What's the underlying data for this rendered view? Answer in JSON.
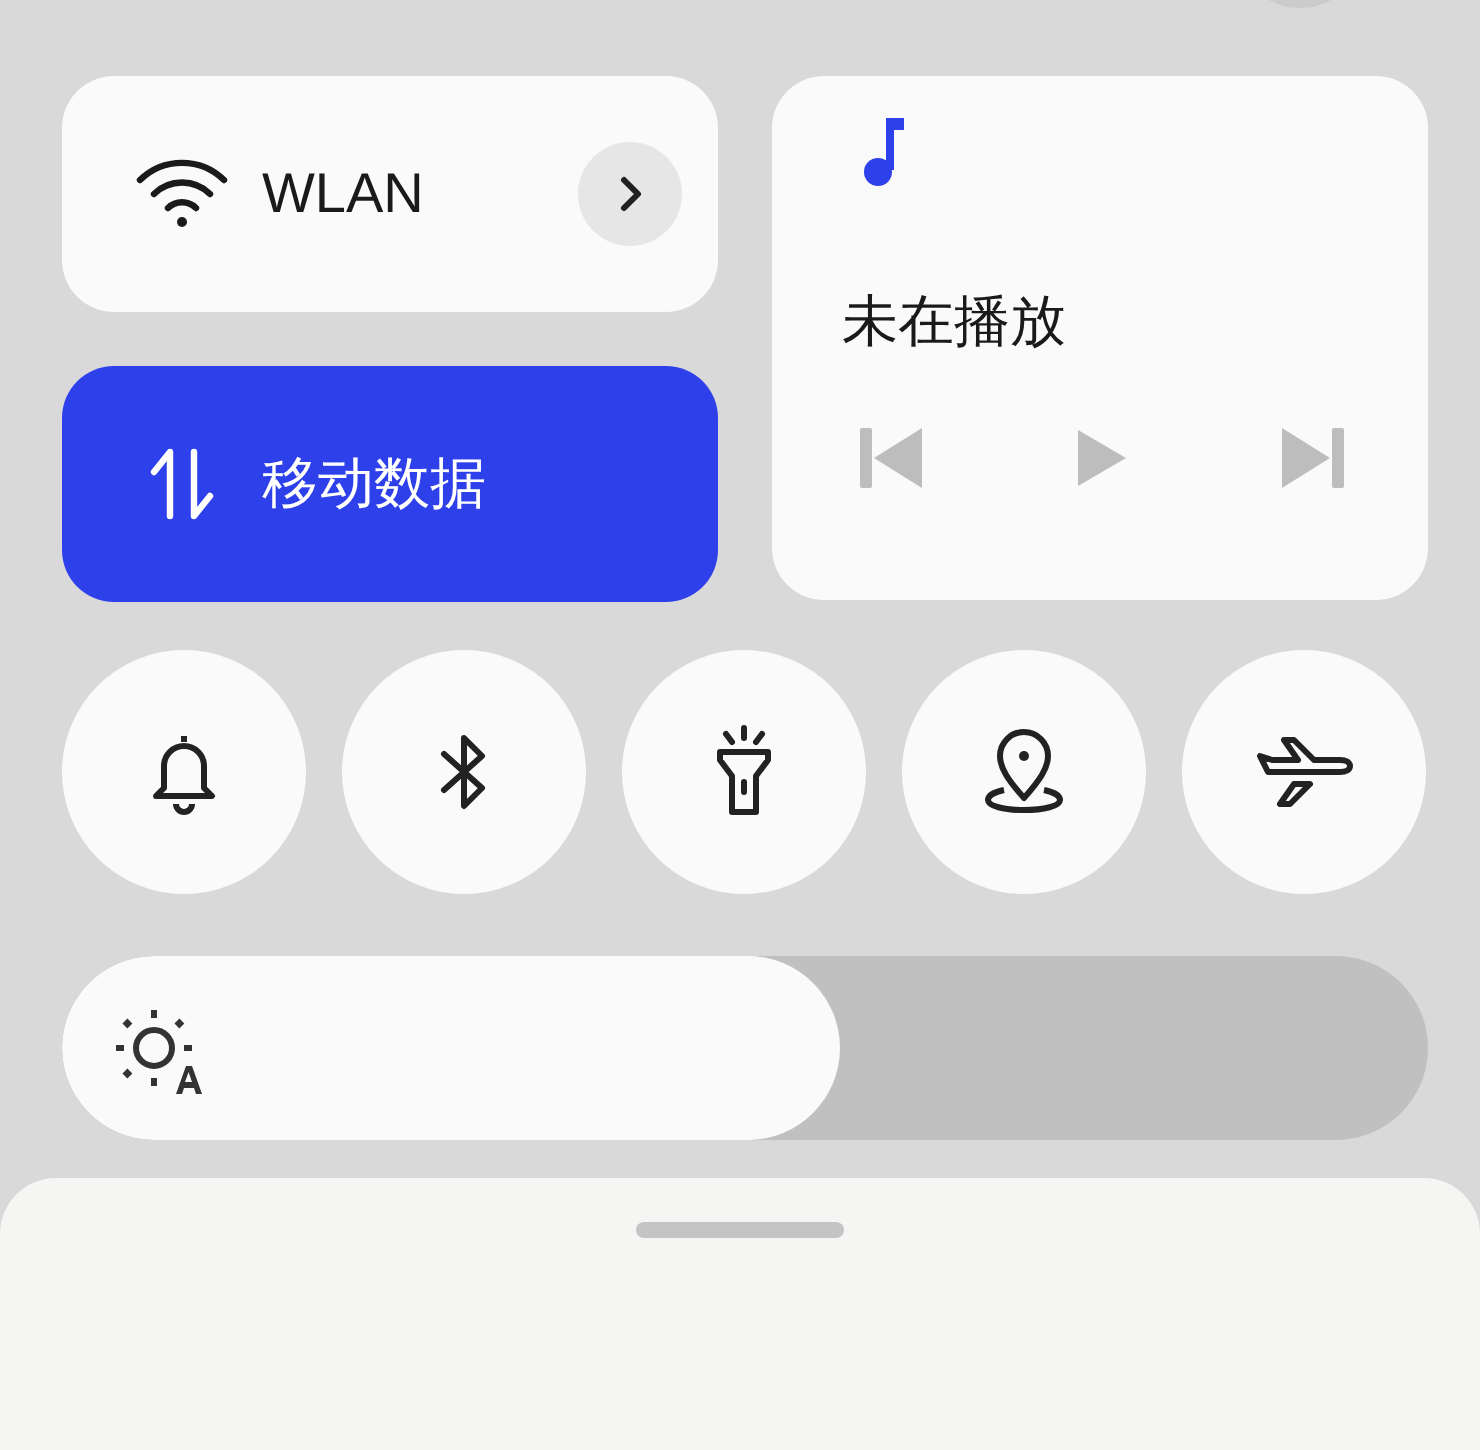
{
  "tiles": [
    {
      "kind": "wifi",
      "label": "WLAN",
      "on": false,
      "has_arrow": true
    },
    {
      "kind": "data",
      "label": "移动数据",
      "on": true,
      "has_arrow": false
    }
  ],
  "media": {
    "title": "未在播放",
    "playing": false
  },
  "toggles": [
    {
      "kind": "bell",
      "on": false
    },
    {
      "kind": "bluetooth",
      "on": false
    },
    {
      "kind": "flashlight",
      "on": false
    },
    {
      "kind": "location",
      "on": false
    },
    {
      "kind": "airplane",
      "on": false
    }
  ],
  "brightness": {
    "level": 0.57
  }
}
